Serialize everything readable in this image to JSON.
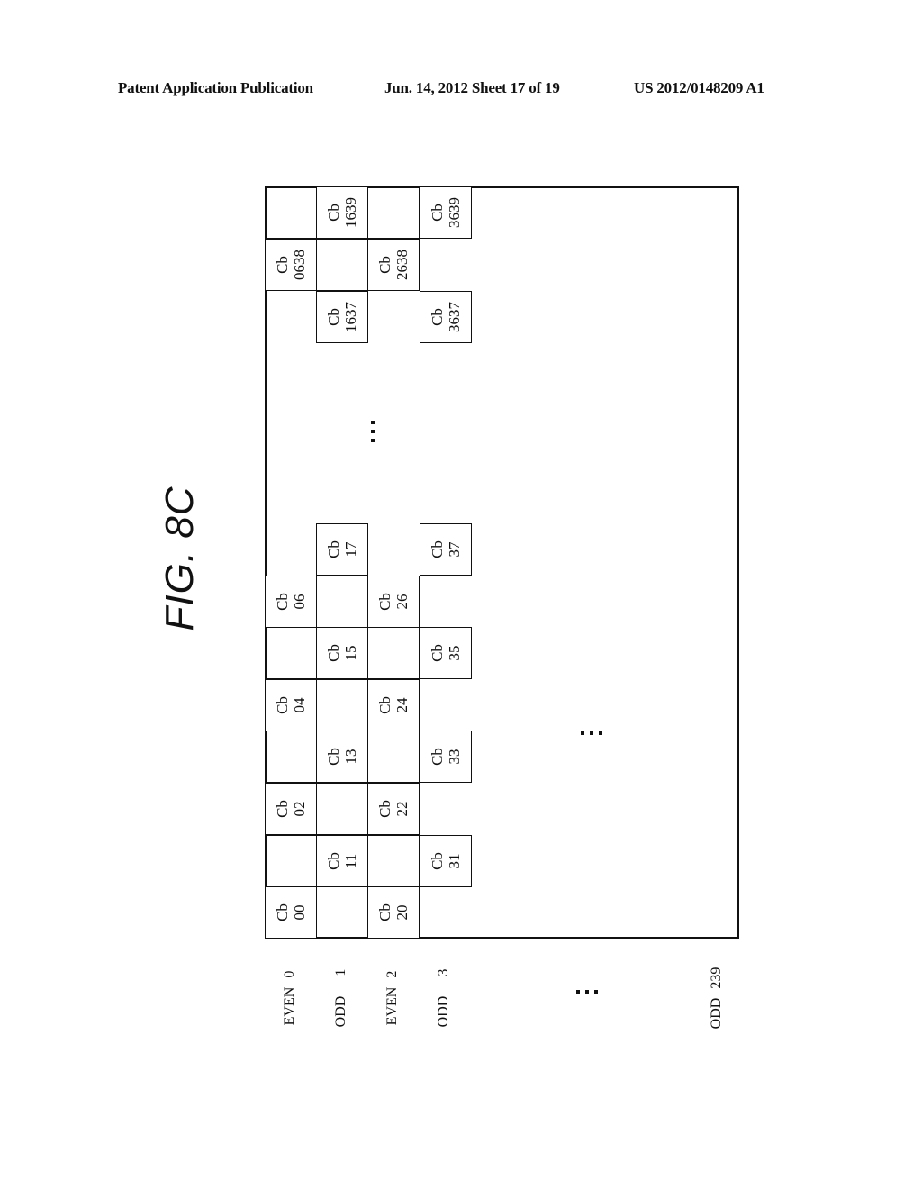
{
  "header": {
    "left": "Patent Application Publication",
    "center": "Jun. 14, 2012  Sheet 17 of 19",
    "right": "US 2012/0148209 A1"
  },
  "figure": {
    "title": "FIG. 8C",
    "rows": [
      {
        "parity": "EVEN",
        "index": "0"
      },
      {
        "parity": "ODD",
        "index": "1"
      },
      {
        "parity": "EVEN",
        "index": "2"
      },
      {
        "parity": "ODD",
        "index": "3"
      },
      {
        "parity": "ODD",
        "index": "239"
      }
    ],
    "cells": [
      {
        "label": "Cb",
        "id": "00"
      },
      {
        "label": "Cb",
        "id": "02"
      },
      {
        "label": "Cb",
        "id": "04"
      },
      {
        "label": "Cb",
        "id": "06"
      },
      {
        "label": "Cb",
        "id": "0638"
      },
      {
        "label": "Cb",
        "id": "11"
      },
      {
        "label": "Cb",
        "id": "13"
      },
      {
        "label": "Cb",
        "id": "15"
      },
      {
        "label": "Cb",
        "id": "17"
      },
      {
        "label": "Cb",
        "id": "1637"
      },
      {
        "label": "Cb",
        "id": "1639"
      },
      {
        "label": "Cb",
        "id": "20"
      },
      {
        "label": "Cb",
        "id": "22"
      },
      {
        "label": "Cb",
        "id": "24"
      },
      {
        "label": "Cb",
        "id": "26"
      },
      {
        "label": "Cb",
        "id": "2638"
      },
      {
        "label": "Cb",
        "id": "31"
      },
      {
        "label": "Cb",
        "id": "33"
      },
      {
        "label": "Cb",
        "id": "35"
      },
      {
        "label": "Cb",
        "id": "37"
      },
      {
        "label": "Cb",
        "id": "3637"
      },
      {
        "label": "Cb",
        "id": "3639"
      }
    ],
    "ellipsis": "..."
  }
}
